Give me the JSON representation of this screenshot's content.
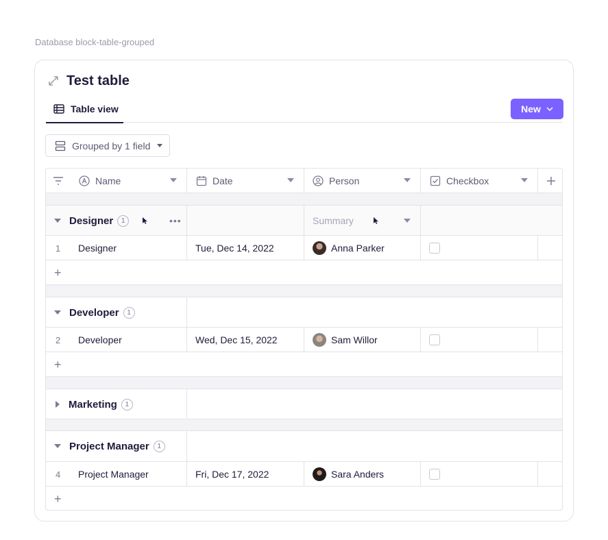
{
  "caption": "Database block-table-grouped",
  "title": "Test table",
  "tab": {
    "label": "Table view"
  },
  "new_button": {
    "label": "New"
  },
  "group_button": {
    "label": "Grouped by 1 field"
  },
  "columns": [
    {
      "label": "Name",
      "icon": "text-circle-icon"
    },
    {
      "label": "Date",
      "icon": "calendar-icon"
    },
    {
      "label": "Person",
      "icon": "person-circle-icon"
    },
    {
      "label": "Checkbox",
      "icon": "checkbox-icon"
    }
  ],
  "groups": [
    {
      "title": "Designer",
      "count": "1",
      "expanded": true,
      "summary": "Summary",
      "rows": [
        {
          "num": "1",
          "name": "Designer",
          "date": "Tue, Dec 14, 2022",
          "person": "Anna Parker",
          "checked": false
        }
      ]
    },
    {
      "title": "Developer",
      "count": "1",
      "expanded": true,
      "rows": [
        {
          "num": "2",
          "name": "Developer",
          "date": "Wed, Dec 15, 2022",
          "person": "Sam Willor",
          "checked": false
        }
      ]
    },
    {
      "title": "Marketing",
      "count": "1",
      "expanded": false,
      "rows": []
    },
    {
      "title": "Project Manager",
      "count": "1",
      "expanded": true,
      "rows": [
        {
          "num": "4",
          "name": "Project Manager",
          "date": "Fri, Dec 17, 2022",
          "person": "Sara Anders",
          "checked": false
        }
      ]
    }
  ],
  "add_symbol": "+",
  "colors": {
    "accent": "#7b61ff",
    "text": "#1f1b3a",
    "muted": "#7d7990",
    "border": "#e3e2e8"
  }
}
